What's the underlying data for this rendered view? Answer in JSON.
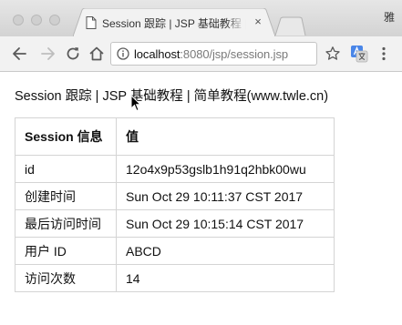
{
  "browser": {
    "tab_title": "Session 跟踪 | JSP 基础教程 | 简单教程",
    "tab_close": "×",
    "profile_name": "雅",
    "url_host": "localhost",
    "url_rest": ":8080/jsp/session.jsp"
  },
  "page": {
    "heading": "Session 跟踪 | JSP 基础教程 | 简单教程(www.twle.cn)",
    "table": {
      "headers": [
        "Session 信息",
        "值"
      ],
      "rows": [
        [
          "id",
          "12o4x9p53gslb1h91q2hbk00wu"
        ],
        [
          "创建时间",
          "Sun Oct 29 10:11:37 CST 2017"
        ],
        [
          "最后访问时间",
          "Sun Oct 29 10:15:14 CST 2017"
        ],
        [
          "用户 ID",
          "ABCD"
        ],
        [
          "访问次数",
          "14"
        ]
      ]
    }
  },
  "icons": {
    "traffic_lights": "window-control-icon",
    "favicon": "document-icon",
    "back": "arrow-left-icon",
    "forward": "arrow-right-icon",
    "reload": "reload-icon",
    "home": "home-icon",
    "site_info": "info-icon",
    "bookmark": "star-icon",
    "extension": "translate-icon",
    "menu": "more-vert-icon"
  },
  "colors": {
    "tabstrip": "#d8d8d8",
    "toolbar": "#f2f2f2",
    "table_border": "#d4d4d4"
  }
}
